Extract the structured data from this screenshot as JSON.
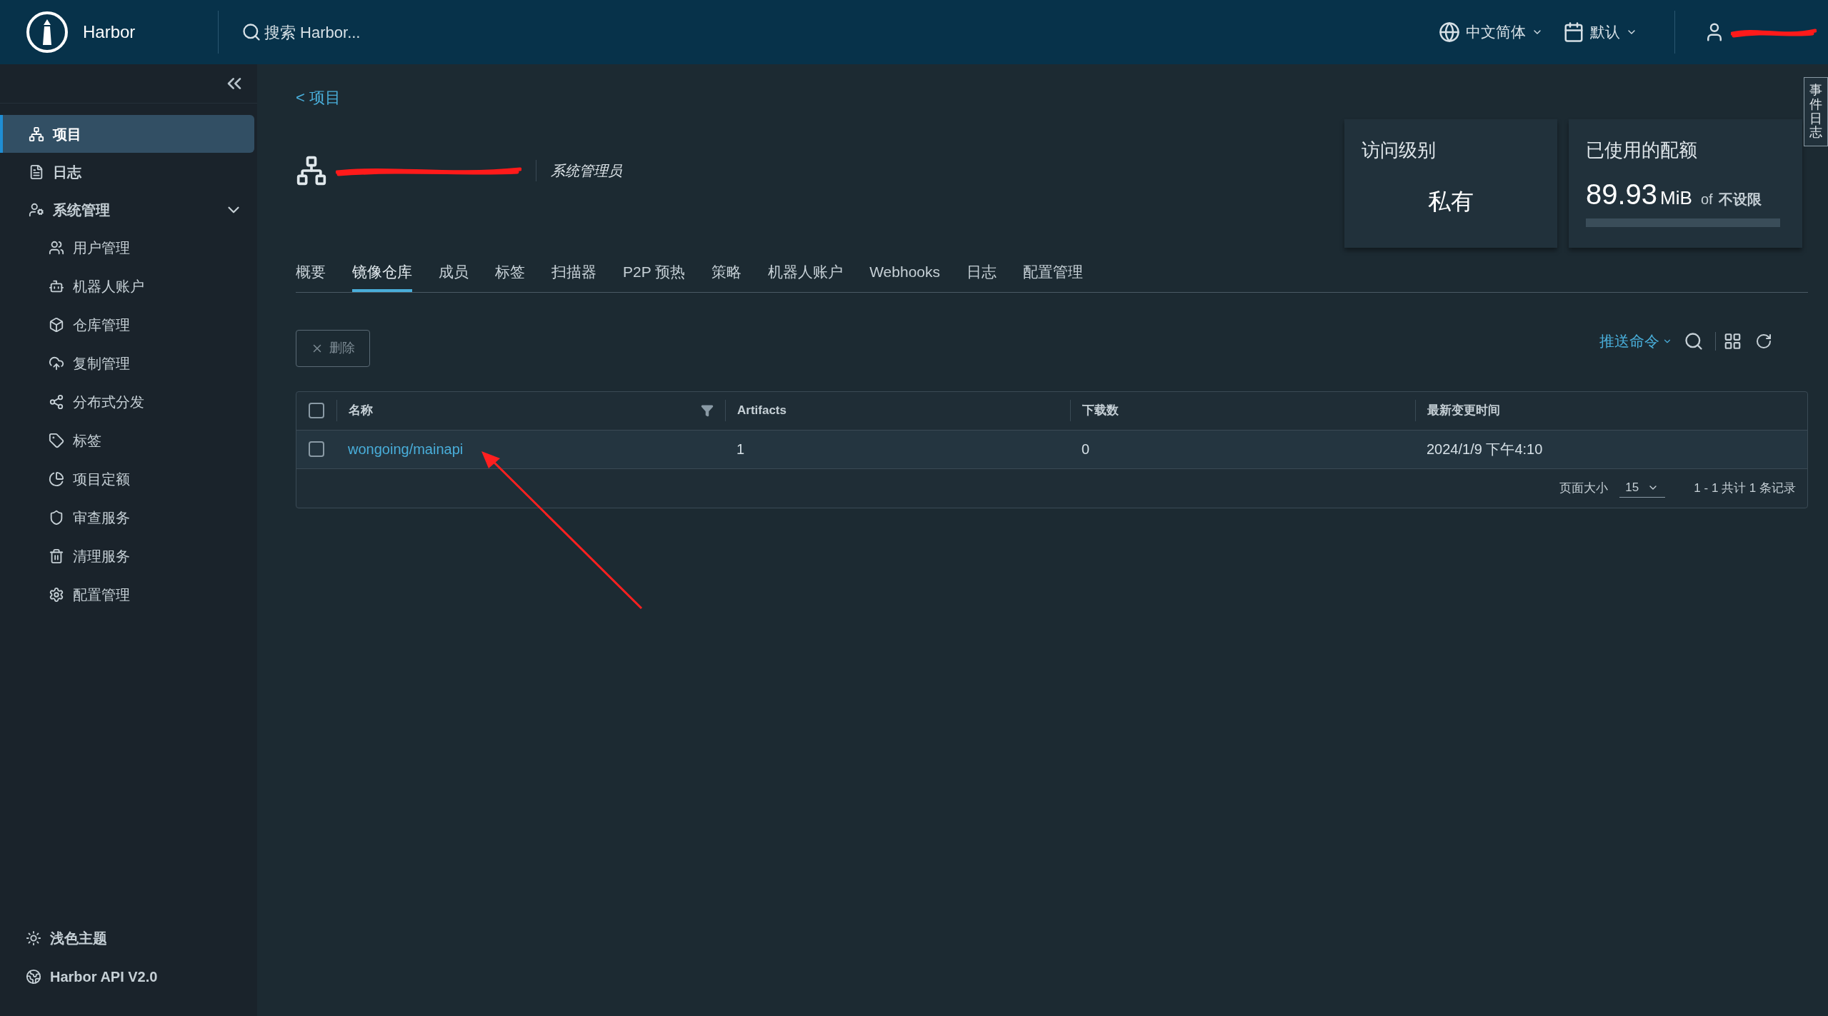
{
  "header": {
    "brand": "Harbor",
    "search": {
      "placeholder": "搜索 Harbor..."
    },
    "language": "中文简体",
    "theme_menu": "默认"
  },
  "sidebar": {
    "items": [
      {
        "label": "项目",
        "selected": true
      },
      {
        "label": "日志",
        "selected": false
      },
      {
        "label": "系统管理",
        "selected": false,
        "expanded": true,
        "children": [
          {
            "label": "用户管理",
            "selected": false
          },
          {
            "label": "机器人账户",
            "selected": false
          },
          {
            "label": "仓库管理",
            "selected": false
          },
          {
            "label": "复制管理",
            "selected": false
          },
          {
            "label": "分布式分发",
            "selected": false
          },
          {
            "label": "标签",
            "selected": false
          },
          {
            "label": "项目定额",
            "selected": false
          },
          {
            "label": "审查服务",
            "selected": false
          },
          {
            "label": "清理服务",
            "selected": false
          },
          {
            "label": "配置管理",
            "selected": false
          }
        ]
      }
    ],
    "footer": [
      "浅色主题",
      "Harbor API V2.0"
    ]
  },
  "breadcrumb": {
    "back": "<",
    "label": "项目"
  },
  "project": {
    "role": "系统管理员"
  },
  "stats": {
    "access_title": "访问级别",
    "access_value": "私有",
    "quota_title": "已使用的配额",
    "quota_value": "89.93",
    "quota_unit": "MiB",
    "quota_of": "of",
    "quota_limit": "不设限"
  },
  "tabs": [
    {
      "label": "概要",
      "selected": false
    },
    {
      "label": "镜像仓库",
      "selected": true
    },
    {
      "label": "成员",
      "selected": false
    },
    {
      "label": "标签",
      "selected": false
    },
    {
      "label": "扫描器",
      "selected": false
    },
    {
      "label": "P2P 预热",
      "selected": false
    },
    {
      "label": "策略",
      "selected": false
    },
    {
      "label": "机器人账户",
      "selected": false
    },
    {
      "label": "Webhooks",
      "selected": false
    },
    {
      "label": "日志",
      "selected": false
    },
    {
      "label": "配置管理",
      "selected": false
    }
  ],
  "toolbar": {
    "delete": "删除",
    "push": "推送命令"
  },
  "table": {
    "columns": [
      "名称",
      "Artifacts",
      "下载数",
      "最新变更时间"
    ],
    "select_all_checked": false,
    "rows": [
      {
        "checked": false,
        "cells": [
          "wongoing/mainapi",
          "1",
          "0",
          "2024/1/9 下午4:10"
        ]
      }
    ],
    "footer": {
      "page_size_label": "页面大小",
      "page_size": "15",
      "summary": "1 - 1 共计 1 条记录"
    }
  },
  "event_log_tab": "事件日志"
}
